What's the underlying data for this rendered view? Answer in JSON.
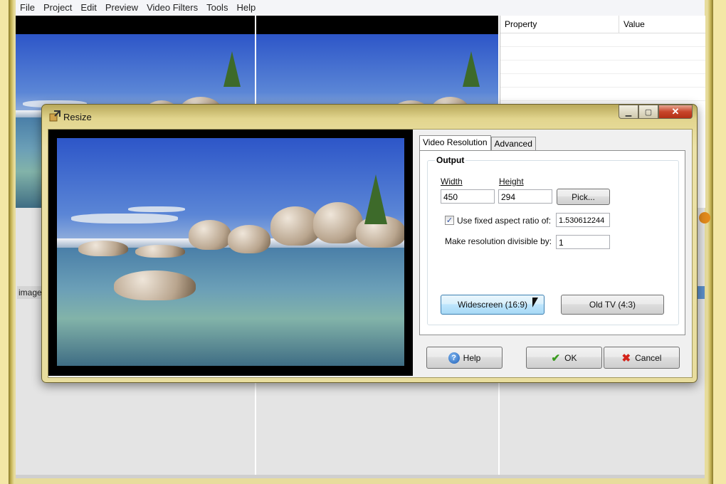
{
  "menu": [
    "File",
    "Project",
    "Edit",
    "Preview",
    "Video Filters",
    "Tools",
    "Help"
  ],
  "properties": {
    "col_property": "Property",
    "col_value": "Value"
  },
  "workspace": {
    "image_label": "image"
  },
  "dialog": {
    "title": "Resize",
    "tabs": [
      "Video Resolution",
      "Advanced"
    ],
    "group_title": "Output",
    "width_label": "Width",
    "height_label": "Height",
    "width_value": "450",
    "height_value": "294",
    "pick_label": "Pick...",
    "aspect_checkbox_label": "Use fixed aspect ratio of:",
    "aspect_checked": true,
    "aspect_value": "1.530612244",
    "divisible_label": "Make resolution divisible by:",
    "divisible_value": "1",
    "widescreen_label": "Widescreen (16:9)",
    "oldtv_label": "Old TV (4:3)",
    "help_label": "Help",
    "ok_label": "OK",
    "cancel_label": "Cancel"
  },
  "icons": {
    "help": "help-icon",
    "ok": "checkmark-icon",
    "cancel": "cancel-x-icon",
    "dialog": "resize-app-icon"
  }
}
